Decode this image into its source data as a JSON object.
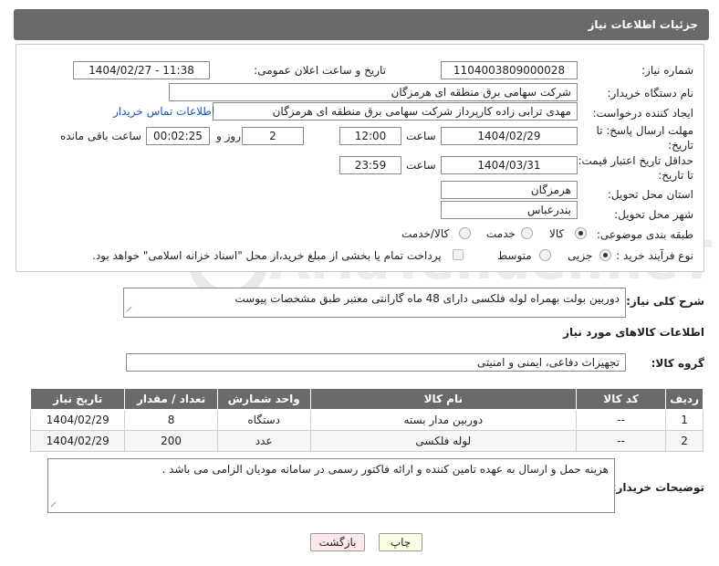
{
  "header": {
    "title": "جزئیات اطلاعات نیاز"
  },
  "form": {
    "need_number": {
      "label": "شماره نیاز:",
      "value": "1104003809000028"
    },
    "announce_datetime": {
      "label": "تاریخ و ساعت اعلان عمومی:",
      "value": "1404/02/27 - 11:38"
    },
    "buyer_org": {
      "label": "نام دستگاه خریدار:",
      "value": "شرکت سهامی برق منطقه ای هرمزگان"
    },
    "requester": {
      "label": "ایجاد کننده درخواست:",
      "value": "مهدی ترابی زاده کارپرداز شرکت سهامی برق منطقه ای هرمزگان",
      "contact_link": "اطلاعات تماس خریدار"
    },
    "reply_deadline": {
      "label": "مهلت ارسال پاسخ: تا تاریخ:",
      "date": "1404/02/29",
      "time_label": "ساعت",
      "time": "12:00",
      "days": "2",
      "days_label": "روز و",
      "remaining": "00:02:25",
      "remaining_label": "ساعت باقی مانده"
    },
    "price_validity": {
      "label": "حداقل تاریخ اعتبار قیمت: تا تاریخ:",
      "date": "1404/03/31",
      "time_label": "ساعت",
      "time": "23:59"
    },
    "province": {
      "label": "استان محل تحویل:",
      "value": "هرمزگان"
    },
    "city": {
      "label": "شهر محل تحویل:",
      "value": "بندرعباس"
    },
    "category": {
      "label": "طبقه بندی موضوعی:",
      "options": [
        "کالا",
        "خدمت",
        "کالا/خدمت"
      ],
      "selected": "کالا"
    },
    "purchase_type": {
      "label": "نوع فرآیند خرید :",
      "options": [
        "جزیی",
        "متوسط"
      ],
      "selected": "جزیی",
      "note": "پرداخت تمام یا بخشی از مبلغ خرید،از محل \"اسناد خزانه اسلامی\" خواهد بود."
    }
  },
  "description": {
    "label": "شرح کلی نیاز:",
    "value": "دوربین بولت بهمراه لوله فلکسی دارای 48 ماه گارانتی معتبر طبق مشخصات پیوست"
  },
  "goods_section": {
    "title": "اطلاعات کالاهای مورد نیاز",
    "group_label": "گروه کالا:",
    "group_value": "تجهیزات دفاعی، ایمنی و امنیتی"
  },
  "table": {
    "headers": [
      "ردیف",
      "کد کالا",
      "نام کالا",
      "واحد شمارش",
      "تعداد / مقدار",
      "تاریخ نیاز"
    ],
    "rows": [
      [
        "1",
        "--",
        "دوربین مدار بسته",
        "دستگاه",
        "8",
        "1404/02/29"
      ],
      [
        "2",
        "--",
        "لوله فلکسی",
        "عدد",
        "200",
        "1404/02/29"
      ]
    ]
  },
  "buyer_notes": {
    "label": "توضیحات خریدار:",
    "value": "هزینه حمل و ارسال به عهده تامین کننده و ارائه فاکتور رسمی در سامانه مودیان الزامی می باشد ."
  },
  "buttons": {
    "print": "چاپ",
    "back": "بازگشت"
  },
  "watermark": {
    "text": "AriaTender.neT"
  },
  "colors": {
    "header_bg": "#6a6a6a",
    "link": "#1a56b8",
    "back_bg": "#fde9e9",
    "print_bg": "#fdfde6"
  }
}
